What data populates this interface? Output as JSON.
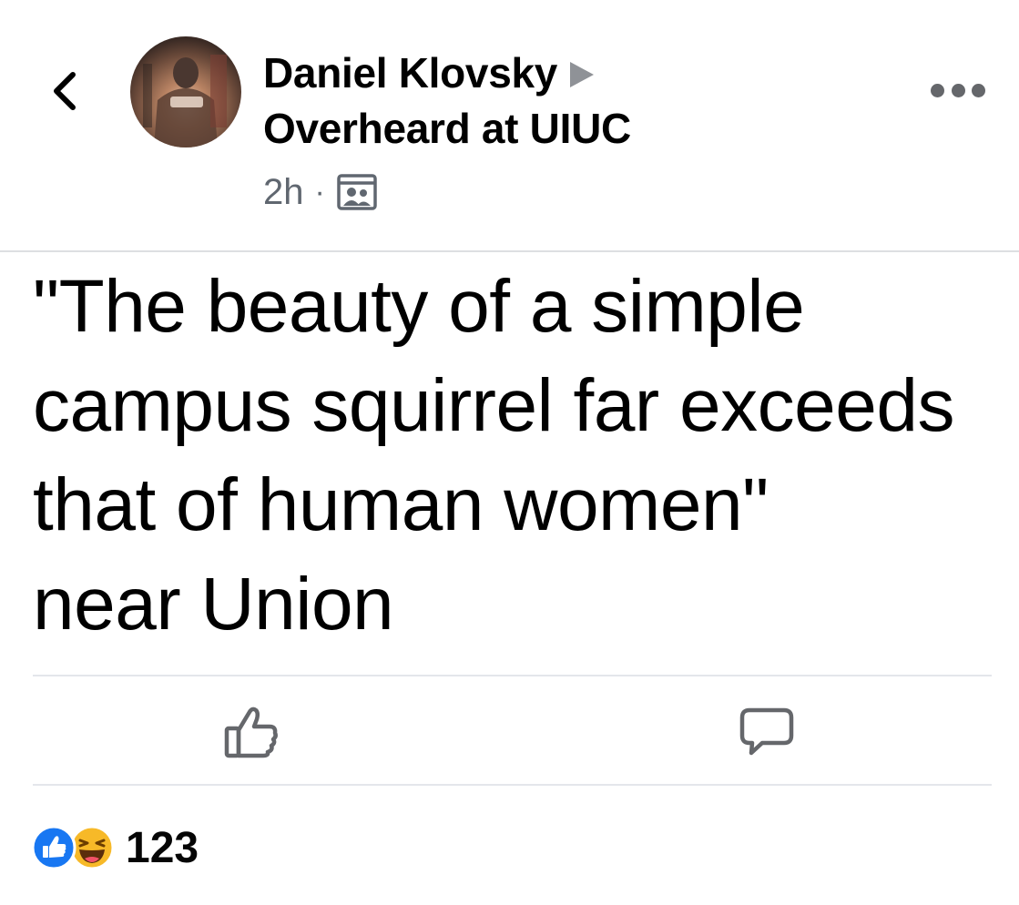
{
  "post": {
    "author_name": "Daniel Klovsky",
    "group_name": "Overheard at UIUC",
    "timestamp": "2h",
    "separator": "·",
    "audience_icon": "group-audience-icon",
    "text": "\"The beauty of a simple\ncampus squirrel far exceeds\nthat of human women\"\nnear Union"
  },
  "header": {
    "back_icon": "chevron-left-icon",
    "more_icon": "more-horizontal-icon"
  },
  "actions": {
    "like_icon": "thumbs-up-icon",
    "comment_icon": "comment-bubble-icon"
  },
  "reactions": {
    "types": [
      "like",
      "haha"
    ],
    "count": "123"
  },
  "colors": {
    "text": "#000000",
    "secondary_text": "#606770",
    "icon_gray": "#65676b",
    "divider": "#dddfe2",
    "like_blue": "#1877f2",
    "haha_yellow": "#f7b928"
  }
}
